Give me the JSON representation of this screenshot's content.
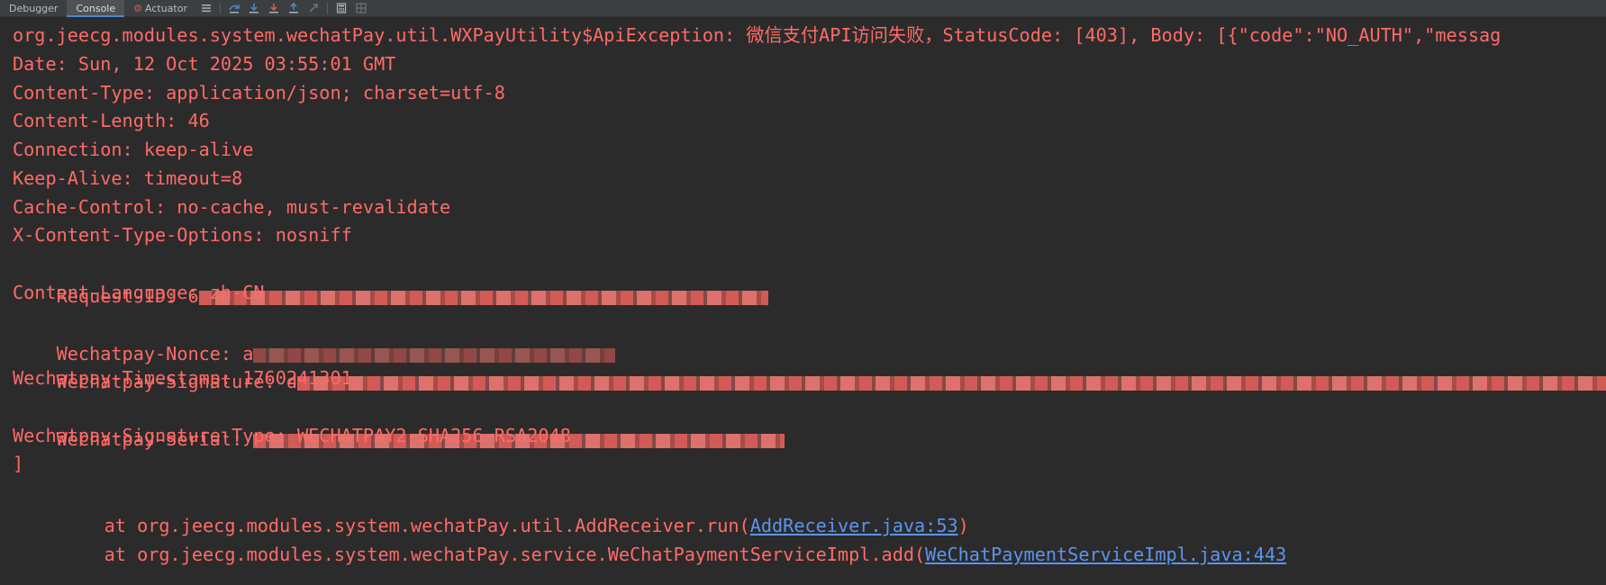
{
  "toolbar": {
    "tabs": [
      {
        "label": "Debugger",
        "active": false
      },
      {
        "label": "Console",
        "active": true
      },
      {
        "label": "Actuator",
        "active": false
      }
    ],
    "icons": [
      "list-icon",
      "step-over-icon",
      "step-into-icon",
      "force-step-into-icon",
      "step-out-icon",
      "run-to-cursor-icon",
      "calculator-icon",
      "grid-icon"
    ]
  },
  "console": {
    "lines": [
      {
        "type": "error",
        "text": "org.jeecg.modules.system.wechatPay.util.WXPayUtility$ApiException: 微信支付API访问失败，StatusCode: [403], Body: [{\"code\":\"NO_AUTH\",\"messag"
      },
      {
        "type": "error",
        "text": "Date: Sun, 12 Oct 2025 03:55:01 GMT"
      },
      {
        "type": "error",
        "text": "Content-Type: application/json; charset=utf-8"
      },
      {
        "type": "error",
        "text": "Content-Length: 46"
      },
      {
        "type": "error",
        "text": "Connection: keep-alive"
      },
      {
        "type": "error",
        "text": "Keep-Alive: timeout=8"
      },
      {
        "type": "error",
        "text": "Cache-Control: no-cache, must-revalidate"
      },
      {
        "type": "error",
        "text": "X-Content-Type-Options: nosniff"
      },
      {
        "type": "redacted",
        "text": "Request-ID: 6"
      },
      {
        "type": "error",
        "text": "Content-Language: zh-CN"
      },
      {
        "type": "redacted",
        "text": "Wechatpay-Nonce: a"
      },
      {
        "type": "redacted",
        "text": "Wechatpay-Signature: d"
      },
      {
        "type": "error",
        "text": "Wechatpay-Timestamp: 1760241301"
      },
      {
        "type": "redacted",
        "text": "Wechatpay-Serial: "
      },
      {
        "type": "error",
        "text": "Wechatpay-Signature-Type: WECHATPAY2-SHA256-RSA2048"
      },
      {
        "type": "error",
        "text": "]"
      }
    ],
    "stack_frame": {
      "prefix": "at org.jeecg.modules.system.wechatPay.util.AddReceiver.run(",
      "link": "AddReceiver.java:53",
      "suffix": ")"
    },
    "stack_frame_partial": {
      "prefix": "at org.jeecg.modules.system.wechatPay.service.WeChatPaymentServiceImpl.add(",
      "link": "WeChatPaymentServiceImpl.java:443"
    }
  },
  "colors": {
    "background": "#2b2b2b",
    "error_text": "#ff6b68",
    "link": "#5c94ed",
    "toolbar": "#3c3f41"
  }
}
